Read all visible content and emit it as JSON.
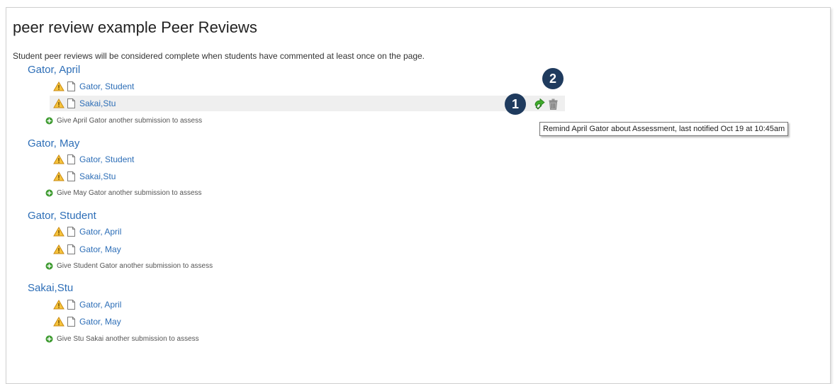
{
  "page": {
    "title": "peer review example Peer Reviews",
    "instructions": "Student peer reviews will be considered complete when students have commented at least once on the page."
  },
  "groups": [
    {
      "name": "Gator, April",
      "submissions": [
        "Gator, Student",
        "Sakai,Stu"
      ],
      "give": "Give April Gator another submission to assess"
    },
    {
      "name": "Gator, May",
      "submissions": [
        "Gator, Student",
        "Sakai,Stu"
      ],
      "give": "Give May Gator another submission to assess"
    },
    {
      "name": "Gator, Student",
      "submissions": [
        "Gator, April",
        "Gator, May"
      ],
      "give": "Give Student Gator another submission to assess"
    },
    {
      "name": "Sakai,Stu",
      "submissions": [
        "Gator, April",
        "Gator, May"
      ],
      "give": "Give Stu Sakai another submission to assess"
    }
  ],
  "callouts": {
    "one": "1",
    "two": "2"
  },
  "tooltip": "Remind April Gator about Assessment, last notified Oct 19 at 10:45am",
  "icons": {
    "status": "warning-icon",
    "submission": "document-icon",
    "add": "plus-circle-icon",
    "remind": "remind-arrow-icon",
    "delete": "trash-icon"
  },
  "colors": {
    "link": "#2d6eb7",
    "callout": "#1f3b5e",
    "highlight_row": "#efefef",
    "add_green": "#3c9a2e",
    "remind_green": "#3faa2a"
  }
}
